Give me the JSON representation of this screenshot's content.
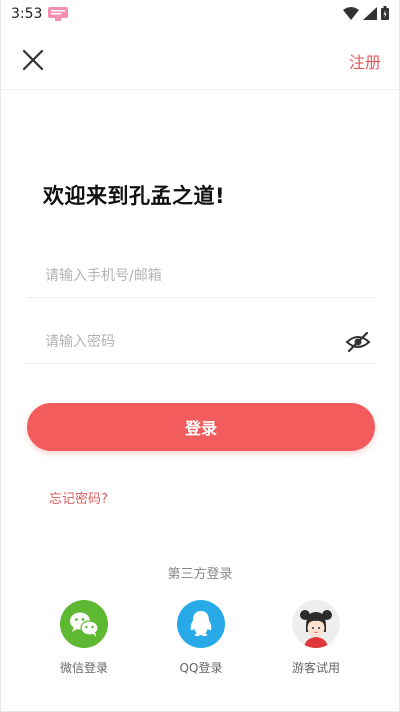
{
  "status_bar": {
    "time": "3:53",
    "icons": [
      "notification-icon",
      "wifi-icon",
      "signal-icon",
      "battery-icon"
    ]
  },
  "top_bar": {
    "close_icon": "close-icon",
    "register_label": "注册"
  },
  "welcome": {
    "title": "欢迎来到孔孟之道!"
  },
  "login_form": {
    "phone_placeholder": "请输入手机号/邮箱",
    "phone_value": "",
    "password_placeholder": "请输入密码",
    "password_value": "",
    "password_toggle_icon": "eye-off-icon",
    "login_label": "登录",
    "forgot_label": "忘记密码?"
  },
  "third_party": {
    "title": "第三方登录",
    "options": [
      {
        "label": "微信登录",
        "icon": "wechat-icon"
      },
      {
        "label": "QQ登录",
        "icon": "qq-icon"
      },
      {
        "label": "游客试用",
        "icon": "guest-avatar-icon"
      }
    ]
  },
  "colors": {
    "accent": "#f25c5c",
    "link": "#e35c5c",
    "wechat": "#5fb832",
    "qq": "#28a9e8"
  }
}
